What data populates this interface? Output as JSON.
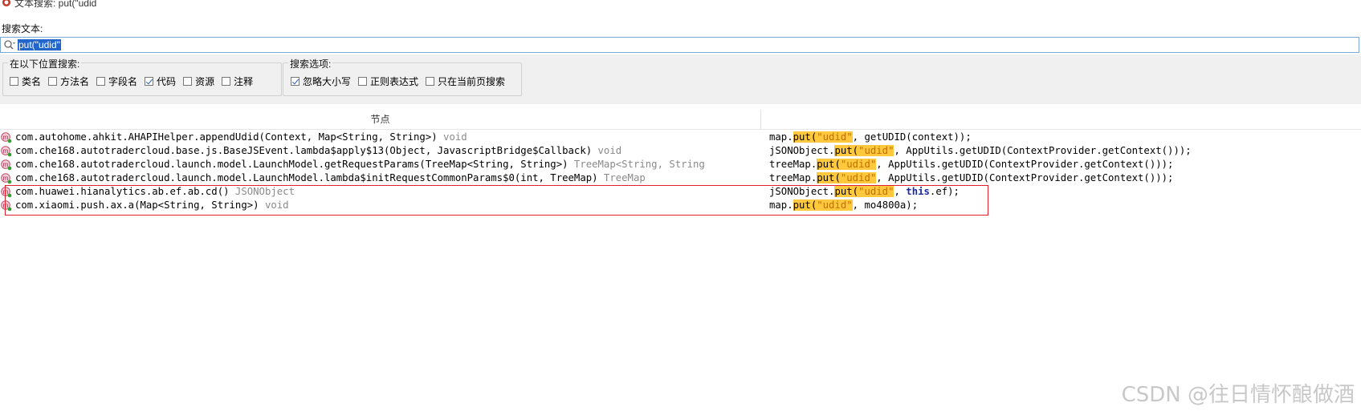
{
  "window": {
    "title": "文本搜索: put(\"udid"
  },
  "search": {
    "label": "搜索文本:",
    "value": "put(\"udid\""
  },
  "scope_group": {
    "legend": "在以下位置搜索:",
    "options": [
      {
        "label": "类名",
        "checked": false
      },
      {
        "label": "方法名",
        "checked": false
      },
      {
        "label": "字段名",
        "checked": false
      },
      {
        "label": "代码",
        "checked": true
      },
      {
        "label": "资源",
        "checked": false
      },
      {
        "label": "注释",
        "checked": false
      }
    ]
  },
  "search_options_group": {
    "legend": "搜索选项:",
    "options": [
      {
        "label": "忽略大小写",
        "checked": true
      },
      {
        "label": "正则表达式",
        "checked": false
      },
      {
        "label": "只在当前页搜索",
        "checked": false
      }
    ]
  },
  "table": {
    "header_node": "节点",
    "rows": [
      {
        "sig": "com.autohome.ahkit.AHAPIHelper.appendUdid(Context, Map<String, String>)",
        "ret": " void",
        "code_pre": "map.",
        "code_hl1": "put(",
        "code_hl2": "\"udid\"",
        "code_mid": ", getUDID(context));",
        "code_post": ""
      },
      {
        "sig": "com.che168.autotradercloud.base.js.BaseJSEvent.lambda$apply$13(Object, JavascriptBridge$Callback)",
        "ret": " void",
        "code_pre": "jSONObject.",
        "code_hl1": "put(",
        "code_hl2": "\"udid\"",
        "code_mid": ", AppUtils.getUDID(ContextProvider.getContext()));",
        "code_post": ""
      },
      {
        "sig": "com.che168.autotradercloud.launch.model.LaunchModel.getRequestParams(TreeMap<String, String>)",
        "ret": " TreeMap<String, String",
        "code_pre": "treeMap.",
        "code_hl1": "put(",
        "code_hl2": "\"udid\"",
        "code_mid": ", AppUtils.getUDID(ContextProvider.getContext()));",
        "code_post": ""
      },
      {
        "sig": "com.che168.autotradercloud.launch.model.LaunchModel.lambda$initRequestCommonParams$0(int, TreeMap)",
        "ret": " TreeMap",
        "code_pre": "treeMap.",
        "code_hl1": "put(",
        "code_hl2": "\"udid\"",
        "code_mid": ", AppUtils.getUDID(ContextProvider.getContext()));",
        "code_post": ""
      },
      {
        "sig": "com.huawei.hianalytics.ab.ef.ab.cd()",
        "ret": " JSONObject",
        "code_pre": "jSONObject.",
        "code_hl1": "put(",
        "code_hl2": "\"udid\"",
        "code_mid": ", ",
        "code_kw": "this",
        "code_post": ".ef);"
      },
      {
        "sig": "com.xiaomi.push.ax.a(Map<String, String>)",
        "ret": " void",
        "code_pre": "map.",
        "code_hl1": "put(",
        "code_hl2": "\"udid\"",
        "code_mid": ", mo4800a);",
        "code_post": ""
      }
    ]
  },
  "watermark": "CSDN @往日情怀酿做酒",
  "colors": {
    "highlight": "#ffc83d",
    "selection": "#2266cc",
    "annotation_box": "#e0202a"
  }
}
